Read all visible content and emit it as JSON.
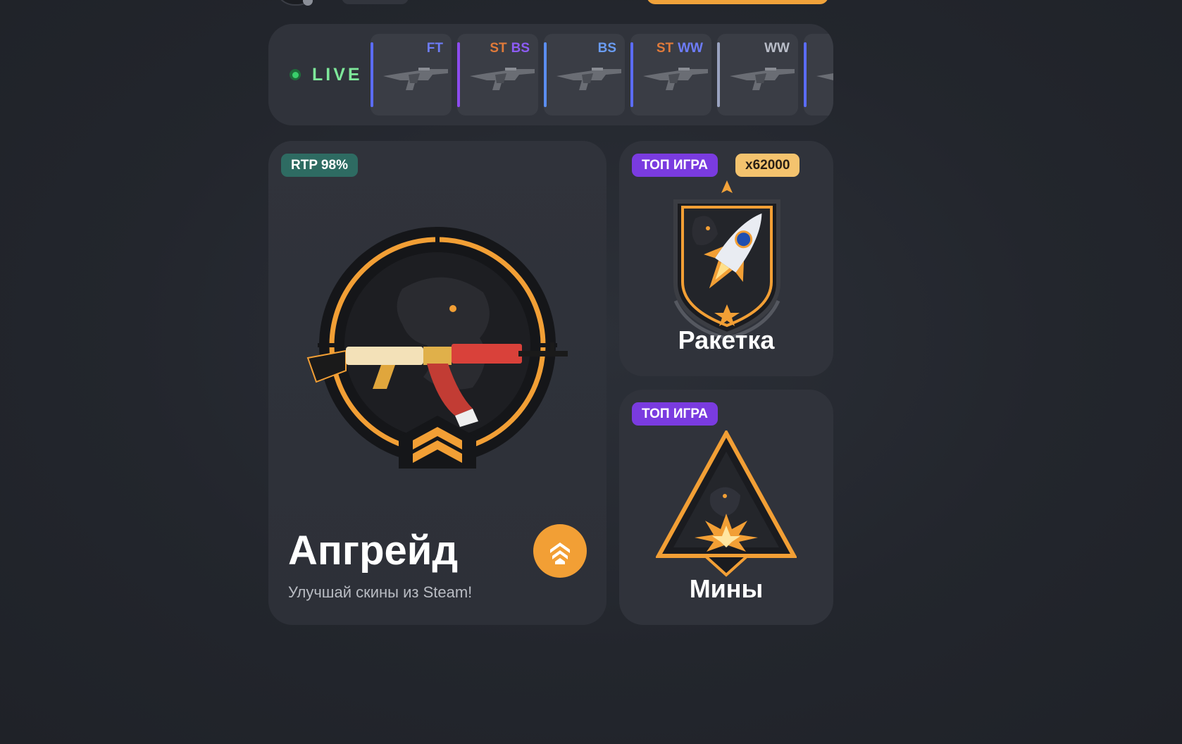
{
  "header": {},
  "live": {
    "label": "LIVE",
    "drops": [
      {
        "tags": [
          "FT"
        ],
        "accent": "#5b6cf5",
        "tag_colors": [
          "#6d7cf7"
        ]
      },
      {
        "tags": [
          "ST",
          "BS"
        ],
        "accent": "#8d4cf0",
        "tag_colors": [
          "#e07a3a",
          "#8d5cf6"
        ]
      },
      {
        "tags": [
          "BS"
        ],
        "accent": "#5b8ef0",
        "tag_colors": [
          "#6a9cf2"
        ]
      },
      {
        "tags": [
          "ST",
          "WW"
        ],
        "accent": "#5b6cf5",
        "tag_colors": [
          "#e07a3a",
          "#6d7cf7"
        ]
      },
      {
        "tags": [
          "WW"
        ],
        "accent": "#9aa3c0",
        "tag_colors": [
          "#b9bdc8"
        ]
      },
      {
        "tags": [],
        "accent": "#5b6cf5",
        "tag_colors": []
      }
    ]
  },
  "upgrade": {
    "badge": "RTP 98%",
    "title": "Апгрейд",
    "subtitle": "Улучшай скины из Steam!"
  },
  "rocket": {
    "badge_top": "ТОП ИГРА",
    "badge_mult": "x62000",
    "title": "Ракетка"
  },
  "mines": {
    "badge_top": "ТОП ИГРА",
    "title": "Мины"
  },
  "colors": {
    "accent_orange": "#f29f35",
    "live_green": "#7ee89a",
    "purple_badge": "#7a3be0",
    "teal_badge": "#2e6b62",
    "gold_badge": "#f4c36e"
  }
}
